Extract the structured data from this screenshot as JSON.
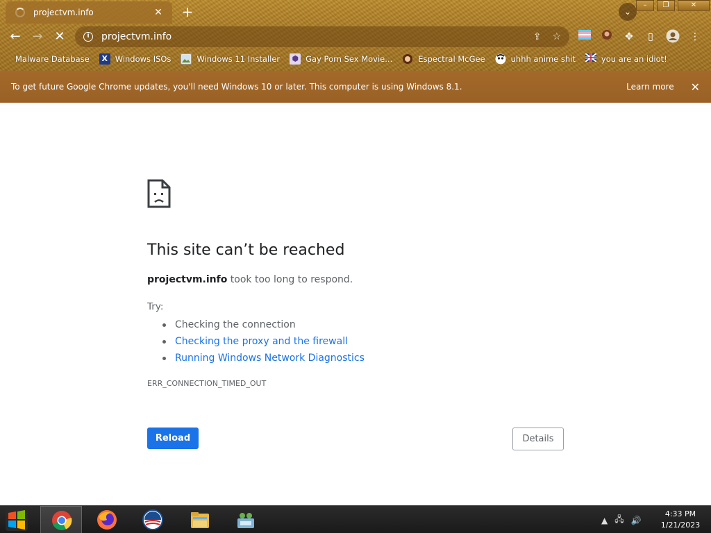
{
  "browser": {
    "tab": {
      "title": "projectvm.info"
    },
    "omnibox": {
      "url": "projectvm.info"
    },
    "bookmarks": [
      {
        "label": "Malware Database",
        "icon": "blank"
      },
      {
        "label": "Windows ISOs",
        "icon": "x-logo",
        "color": "#1e3a8a"
      },
      {
        "label": "Windows 11 Installer",
        "icon": "image",
        "color": "#6b8e23"
      },
      {
        "label": "Gay Porn Sex Movie...",
        "icon": "box",
        "color": "#5b3a8a"
      },
      {
        "label": "Espectral McGee",
        "icon": "avatar",
        "color": "#c0392b"
      },
      {
        "label": "uhhh anime shit",
        "icon": "anime",
        "color": "#444444"
      },
      {
        "label": "you are an idiot!",
        "icon": "flag-uk",
        "color": "#1e3a8a"
      }
    ],
    "infobar": {
      "message": "To get future Google Chrome updates, you'll need Windows 10 or later. This computer is using Windows 8.1.",
      "action": "Learn more"
    }
  },
  "error_page": {
    "title": "This site can’t be reached",
    "host": "projectvm.info",
    "reason": "took too long to respond.",
    "try_label": "Try:",
    "suggestions": [
      {
        "text": "Checking the connection",
        "link": false
      },
      {
        "text": "Checking the proxy and the firewall",
        "link": true
      },
      {
        "text": "Running Windows Network Diagnostics",
        "link": true
      }
    ],
    "error_code": "ERR_CONNECTION_TIMED_OUT",
    "reload_label": "Reload",
    "details_label": "Details"
  },
  "taskbar": {
    "apps": [
      "Google Chrome",
      "Firefox",
      "Obama app",
      "File Explorer",
      "Network app"
    ],
    "time": "4:33 PM",
    "date": "1/21/2023"
  },
  "theme": {
    "accent_blue": "#1a73e8",
    "frame_brown": "#a87a28",
    "infobar_brown": "#9a6126"
  }
}
